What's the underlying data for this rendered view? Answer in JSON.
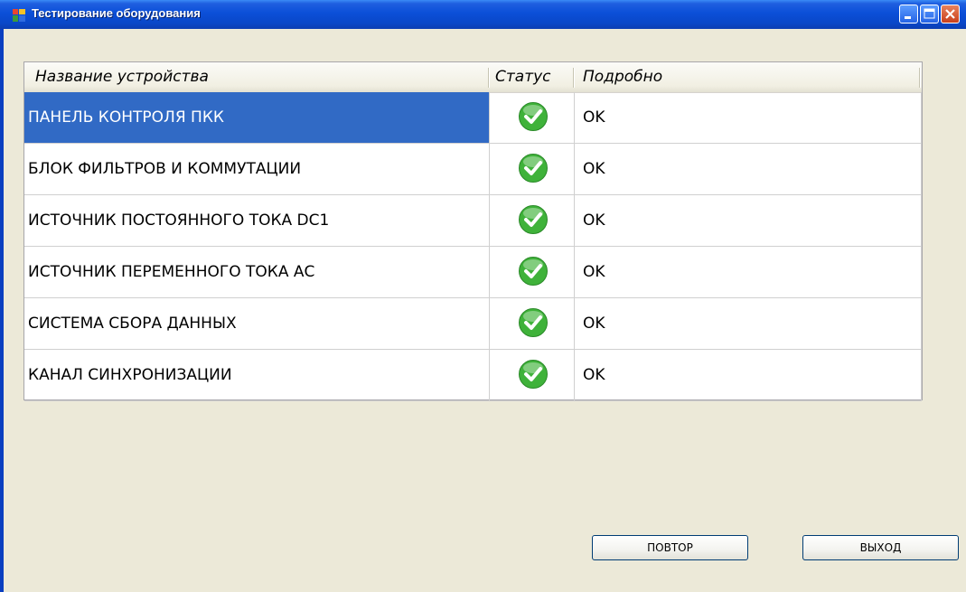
{
  "window": {
    "title": "Тестирование оборудования"
  },
  "grid": {
    "columns": [
      "Название устройства",
      "Статус",
      "Подробно"
    ],
    "rows": [
      {
        "name": "ПАНЕЛЬ КОНТРОЛЯ ПКК",
        "status_icon": "check-ok-icon",
        "detail": "OK",
        "selected": true
      },
      {
        "name": "БЛОК ФИЛЬТРОВ И КОММУТАЦИИ",
        "status_icon": "check-ok-icon",
        "detail": "OK",
        "selected": false
      },
      {
        "name": "ИСТОЧНИК ПОСТОЯННОГО ТОКА DC1",
        "status_icon": "check-ok-icon",
        "detail": "OK",
        "selected": false
      },
      {
        "name": "ИСТОЧНИК ПЕРЕМЕННОГО ТОКА АС",
        "status_icon": "check-ok-icon",
        "detail": "OK",
        "selected": false
      },
      {
        "name": "СИСТЕМА СБОРА ДАННЫХ",
        "status_icon": "check-ok-icon",
        "detail": "OK",
        "selected": false
      },
      {
        "name": "КАНАЛ СИНХРОНИЗАЦИИ",
        "status_icon": "check-ok-icon",
        "detail": "OK",
        "selected": false
      }
    ]
  },
  "buttons": {
    "retry": "ПОВТОР",
    "exit": "ВЫХОД"
  },
  "colors": {
    "selection": "#316ac5",
    "status_ok": "#3fb23a",
    "window_bg": "#ece9d8",
    "titlebar": "#0a47c8"
  }
}
